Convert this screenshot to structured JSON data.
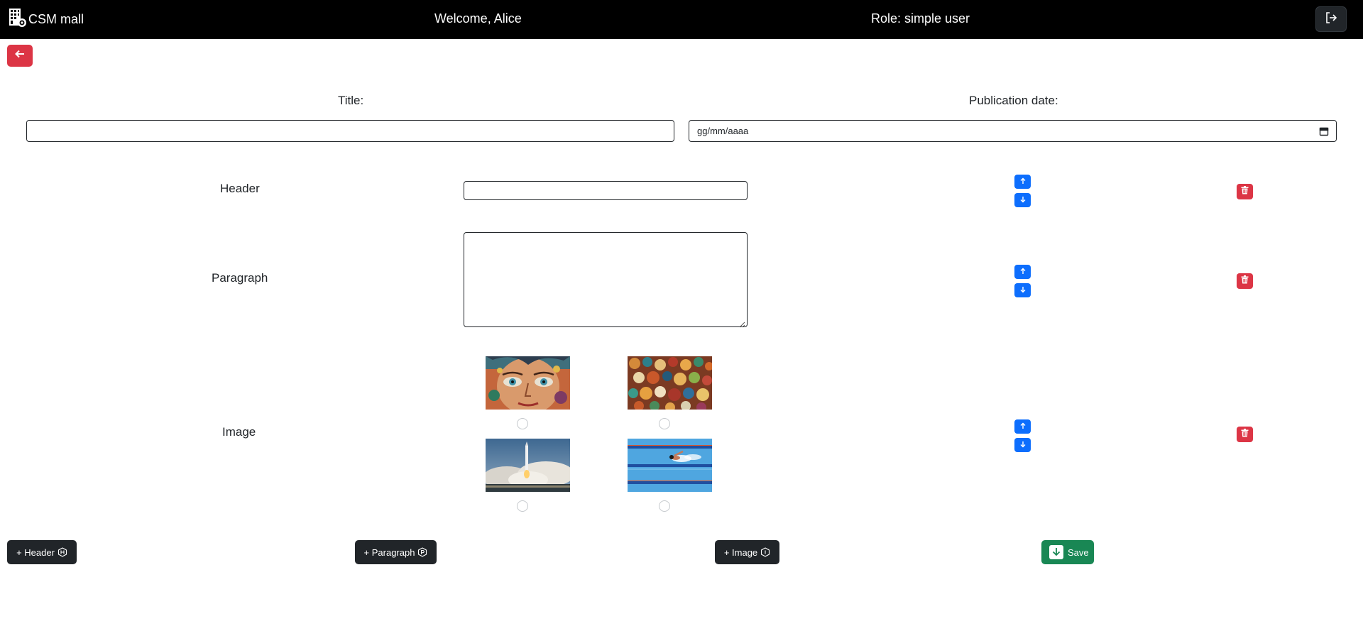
{
  "navbar": {
    "brand": "CSM mall",
    "brand_icon": "building-gear-icon",
    "welcome": "Welcome, Alice",
    "role": "Role: simple user",
    "logout_icon": "logout-icon"
  },
  "back_button": {
    "icon": "arrow-left-icon"
  },
  "form": {
    "title_label": "Title:",
    "title_value": "",
    "date_label": "Publication date:",
    "date_placeholder": "gg/mm/aaaa"
  },
  "sections": {
    "header": {
      "label": "Header",
      "value": ""
    },
    "paragraph": {
      "label": "Paragraph",
      "value": ""
    },
    "image": {
      "label": "Image",
      "options": [
        {
          "name": "graffiti-face",
          "selected": false
        },
        {
          "name": "colorful-beads",
          "selected": false
        },
        {
          "name": "rocket-launch",
          "selected": false
        },
        {
          "name": "swimmer-pool",
          "selected": false
        }
      ]
    }
  },
  "buttons": {
    "add_header": "+ Header",
    "add_paragraph": "+ Paragraph",
    "add_image": "+ Image",
    "save": "Save"
  },
  "colors": {
    "navbar": "#000000",
    "danger": "#dc3545",
    "primary": "#0d6efd",
    "dark": "#212529",
    "success": "#198754"
  }
}
